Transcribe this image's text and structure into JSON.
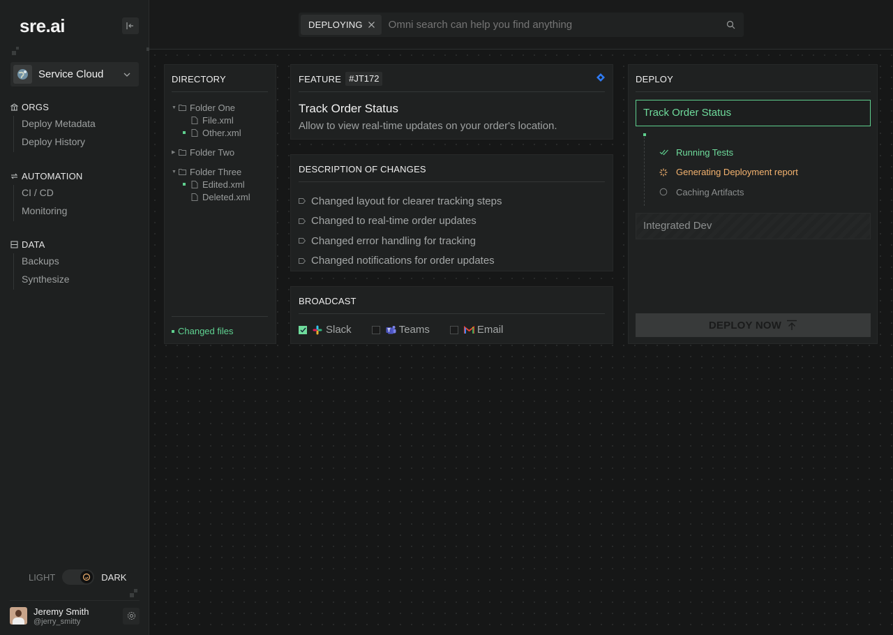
{
  "app": {
    "logo": "sre.ai"
  },
  "org": {
    "name": "Service Cloud"
  },
  "nav": {
    "sections": [
      {
        "label": "ORGS",
        "items": [
          "Deploy Metadata",
          "Deploy History"
        ]
      },
      {
        "label": "AUTOMATION",
        "items": [
          "CI / CD",
          "Monitoring"
        ]
      },
      {
        "label": "DATA",
        "items": [
          "Backups",
          "Synthesize"
        ]
      }
    ]
  },
  "theme": {
    "light": "LIGHT",
    "dark": "DARK",
    "active": "dark"
  },
  "user": {
    "name": "Jeremy Smith",
    "handle": "@jerry_smitty"
  },
  "search": {
    "chip": "DEPLOYING",
    "placeholder": "Omni search can help you find anything"
  },
  "directory": {
    "title": "DIRECTORY",
    "folders": [
      {
        "name": "Folder One",
        "expanded": true,
        "files": [
          {
            "name": "File.xml",
            "changed": false
          },
          {
            "name": "Other.xml",
            "changed": true
          }
        ]
      },
      {
        "name": "Folder Two",
        "expanded": false,
        "files": []
      },
      {
        "name": "Folder Three",
        "expanded": true,
        "files": [
          {
            "name": "Edited.xml",
            "changed": true
          },
          {
            "name": "Deleted.xml",
            "changed": false
          }
        ]
      }
    ],
    "legend": "Changed files"
  },
  "feature": {
    "title": "FEATURE",
    "tag": "#JT172",
    "name": "Track Order Status",
    "description": "Allow to view real-time updates on your order's location."
  },
  "changes": {
    "title": "DESCRIPTION OF CHANGES",
    "items": [
      "Changed layout for clearer tracking steps",
      "Changed to real-time order updates",
      "Changed error handling for tracking",
      "Changed notifications for order updates"
    ]
  },
  "broadcast": {
    "title": "BROADCAST",
    "channels": [
      {
        "label": "Slack",
        "checked": true
      },
      {
        "label": "Teams",
        "checked": false
      },
      {
        "label": "Email",
        "checked": false
      }
    ]
  },
  "deploy": {
    "title": "DEPLOY",
    "target": "Track Order Status",
    "steps": [
      {
        "label": "Running Tests",
        "status": "done"
      },
      {
        "label": "Generating Deployment report",
        "status": "running"
      },
      {
        "label": "Caching Artifacts",
        "status": "pending"
      }
    ],
    "environment": "Integrated Dev",
    "button": "DEPLOY NOW"
  },
  "colors": {
    "accent": "#5fd08f",
    "warning": "#f4b36f",
    "link": "#3b82f6"
  }
}
